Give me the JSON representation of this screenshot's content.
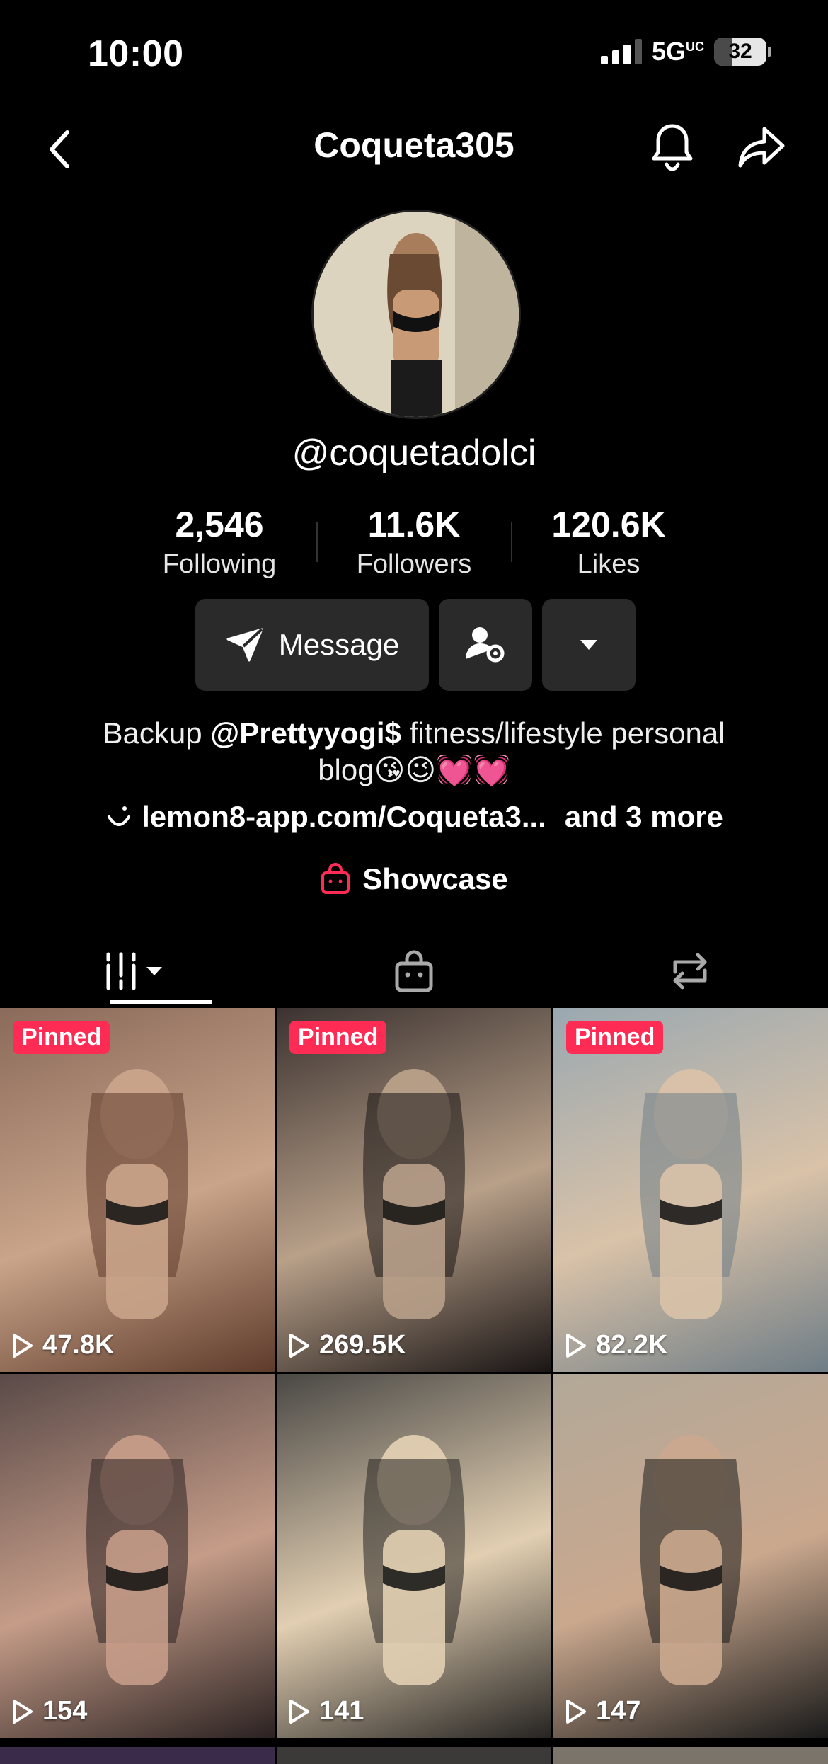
{
  "status_bar": {
    "time": "10:00",
    "network": "5G",
    "network_sup": "UC",
    "battery": "32"
  },
  "header": {
    "title": "Coqueta305",
    "icons": [
      "back-icon",
      "bell-icon",
      "share-icon"
    ]
  },
  "profile": {
    "handle": "@coquetadolci",
    "stats": [
      {
        "value": "2,546",
        "label": "Following"
      },
      {
        "value": "11.6K",
        "label": "Followers"
      },
      {
        "value": "120.6K",
        "label": "Likes"
      }
    ],
    "message_label": "Message",
    "bio_prefix": "Backup ",
    "bio_mention": "@Prettyyogi$",
    "bio_suffix": " fitness/lifestyle personal blog😘😉💓💓",
    "link_text": "lemon8-app.com/Coqueta3...",
    "link_more": "and 3 more",
    "showcase_label": "Showcase"
  },
  "tabs": [
    "videos-grid-icon",
    "shop-bag-icon",
    "repost-icon"
  ],
  "videos": [
    {
      "pinned": "Pinned",
      "views": "47.8K",
      "colors": [
        "#8a6a5a",
        "#c9a48a",
        "#5e3b2b"
      ]
    },
    {
      "pinned": "Pinned",
      "views": "269.5K",
      "colors": [
        "#3b3230",
        "#b8a089",
        "#1a1515"
      ]
    },
    {
      "pinned": "Pinned",
      "views": "82.2K",
      "colors": [
        "#9aa8b0",
        "#d9c2a8",
        "#6f7d86"
      ]
    },
    {
      "pinned": "",
      "views": "154",
      "colors": [
        "#5a4a48",
        "#c59c88",
        "#2b2222"
      ]
    },
    {
      "pinned": "",
      "views": "141",
      "colors": [
        "#4a4845",
        "#e2cfb2",
        "#262422"
      ]
    },
    {
      "pinned": "",
      "views": "147",
      "colors": [
        "#b2a898",
        "#caa88e",
        "#1a1a1a"
      ]
    }
  ],
  "colors": {
    "accent": "#fe2c55",
    "button_bg": "#2a2a2a",
    "background": "#000000"
  }
}
